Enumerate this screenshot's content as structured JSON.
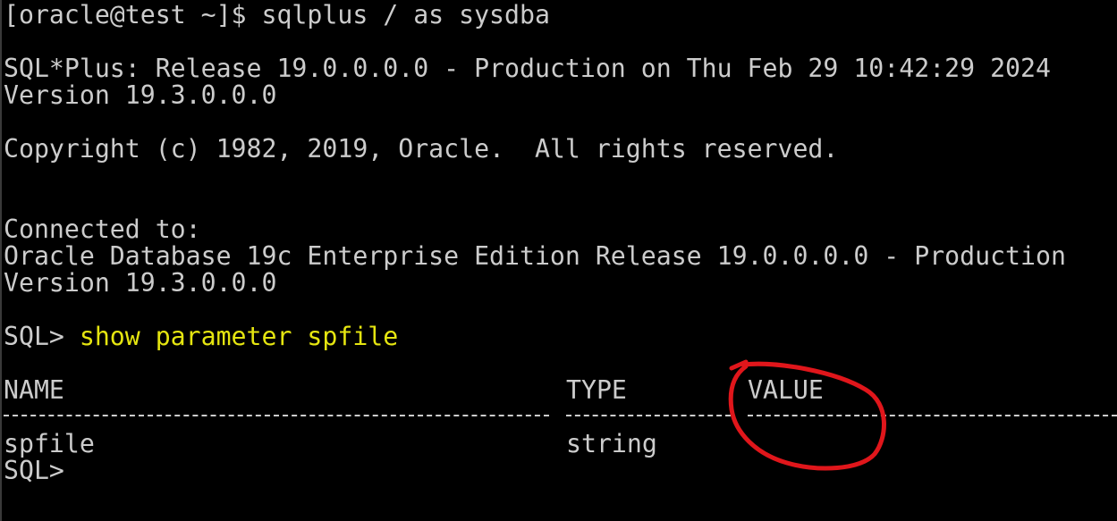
{
  "terminal": {
    "prompt_line": "[oracle@test ~]$ sqlplus / as sysdba",
    "banner_release": "SQL*Plus: Release 19.0.0.0.0 - Production on Thu Feb 29 10:42:29 2024",
    "banner_version": "Version 19.3.0.0.0",
    "copyright": "Copyright (c) 1982, 2019, Oracle.  All rights reserved.",
    "connected_to": "Connected to:",
    "db_edition": "Oracle Database 19c Enterprise Edition Release 19.0.0.0.0 - Production",
    "db_version": "Version 19.3.0.0.0",
    "sql_prompt": "SQL> ",
    "sql_command": "show parameter spfile",
    "table": {
      "headers": [
        "NAME",
        "TYPE",
        "VALUE"
      ],
      "rows": [
        {
          "name": "spfile",
          "type": "string",
          "value": ""
        }
      ]
    },
    "final_prompt": "SQL>"
  },
  "colors": {
    "background": "#000000",
    "text": "#cccccc",
    "command": "#e5e510",
    "annotation": "#e0161b"
  }
}
